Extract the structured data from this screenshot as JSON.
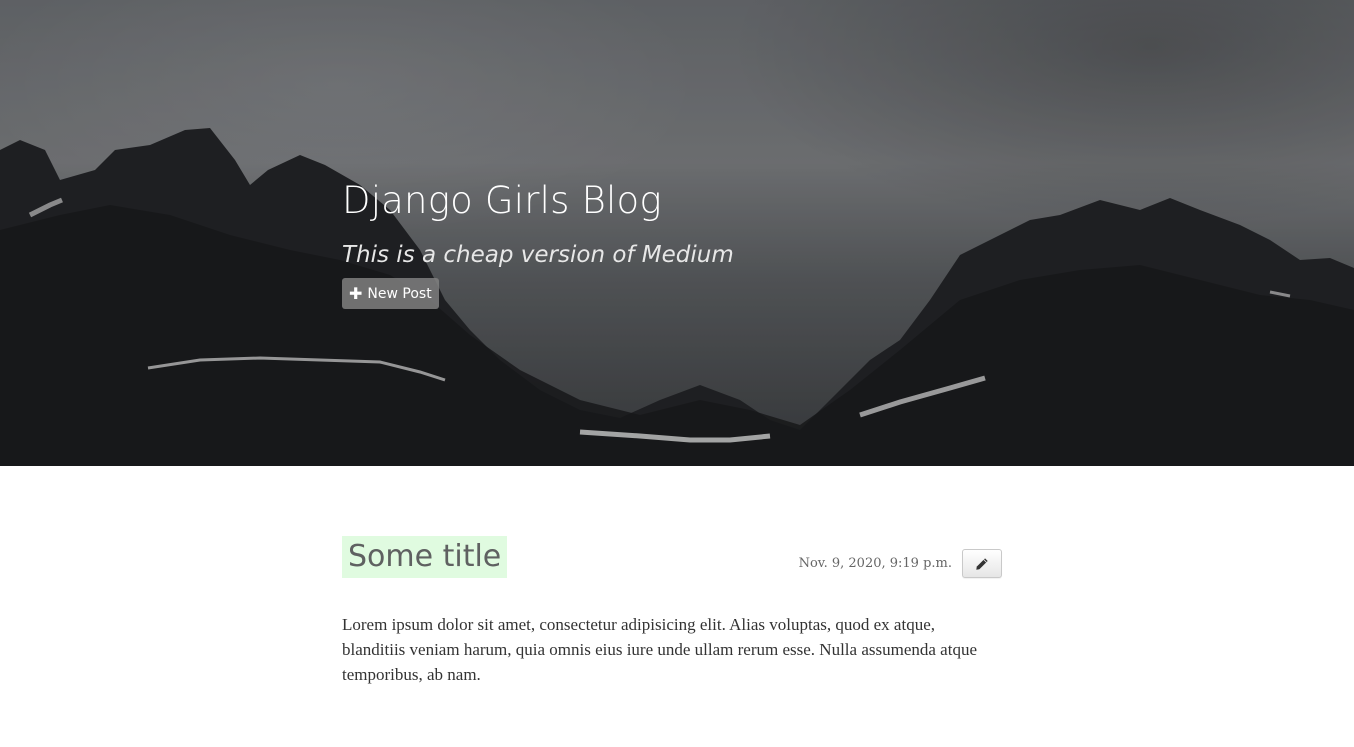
{
  "header": {
    "title": "Django Girls Blog",
    "subtitle": "This is a cheap version of Medium",
    "new_post_label": "New Post"
  },
  "post": {
    "title": "Some title",
    "date": "Nov. 9, 2020, 9:19 p.m.",
    "body": "Lorem ipsum dolor sit amet, consectetur adipisicing elit. Alias voluptas, quod ex atque, blanditiis veniam harum, quia omnis eius iure unde ullam rerum esse. Nulla assumenda atque temporibus, ab nam."
  },
  "icons": {
    "new_post": "plus-icon",
    "edit": "pencil-icon"
  },
  "colors": {
    "title_highlight": "#e0fbe0",
    "hero_overlay": "#3b3d40"
  }
}
